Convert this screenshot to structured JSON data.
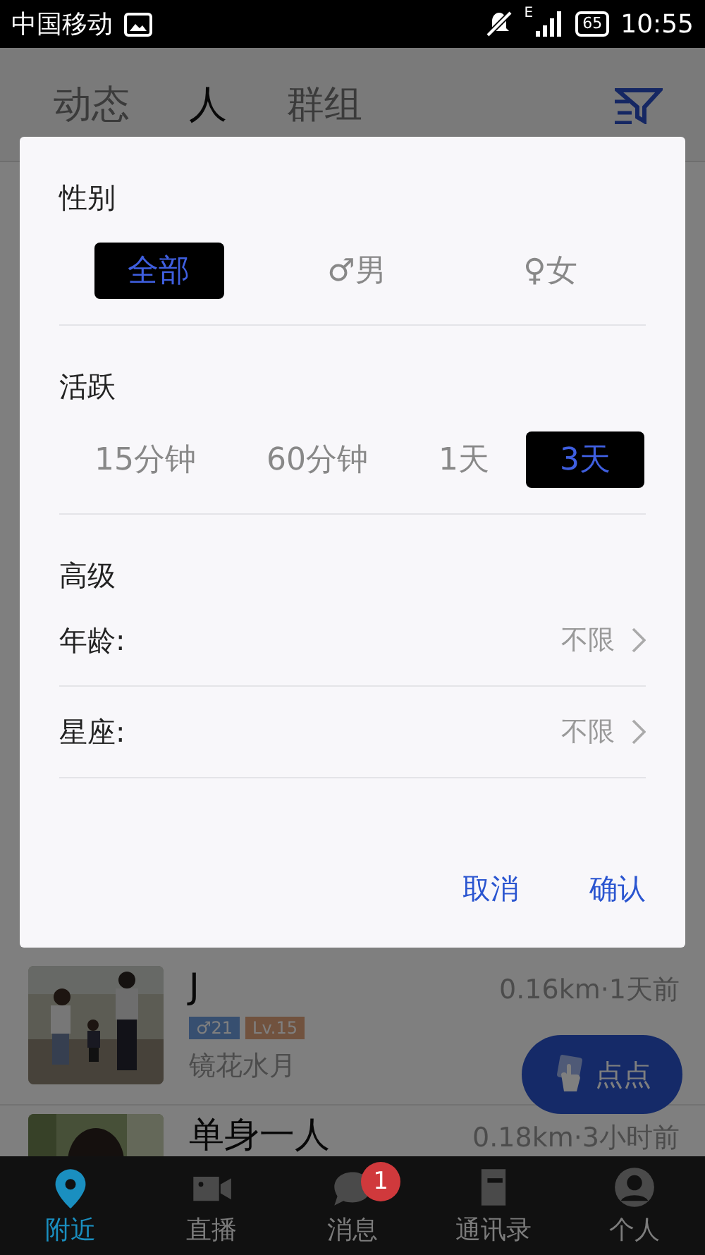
{
  "status_bar": {
    "carrier": "中国移动",
    "network": "E",
    "battery": "65",
    "time": "10:55"
  },
  "tabs": [
    {
      "label": "动态",
      "selected": false
    },
    {
      "label": "人",
      "selected": true
    },
    {
      "label": "群组",
      "selected": false
    }
  ],
  "people": [
    {
      "name": "J",
      "distance_time": "0.16km·1天前",
      "gender_age": "♂21",
      "level": "Lv.15",
      "signature": "镜花水月"
    },
    {
      "name": "单身一人",
      "distance_time": "0.18km·3小时前"
    }
  ],
  "float_button": {
    "label": "点点"
  },
  "bottom_nav": [
    {
      "label": "附近",
      "selected": true
    },
    {
      "label": "直播",
      "selected": false
    },
    {
      "label": "消息",
      "selected": false,
      "badge": "1"
    },
    {
      "label": "通讯录",
      "selected": false
    },
    {
      "label": "个人",
      "selected": false
    }
  ],
  "filter_dialog": {
    "gender": {
      "title": "性别",
      "options": [
        {
          "label": "全部",
          "selected": true
        },
        {
          "label": "♂男",
          "selected": false
        },
        {
          "label": "♀女",
          "selected": false
        }
      ]
    },
    "activity": {
      "title": "活跃",
      "options": [
        {
          "label": "15分钟",
          "selected": false
        },
        {
          "label": "60分钟",
          "selected": false
        },
        {
          "label": "1天",
          "selected": false
        },
        {
          "label": "3天",
          "selected": true
        }
      ]
    },
    "advanced": {
      "title": "高级",
      "rows": [
        {
          "label": "年龄:",
          "value": "不限"
        },
        {
          "label": "星座:",
          "value": "不限"
        }
      ]
    },
    "buttons": [
      {
        "label": "取消"
      },
      {
        "label": "确认"
      }
    ]
  }
}
